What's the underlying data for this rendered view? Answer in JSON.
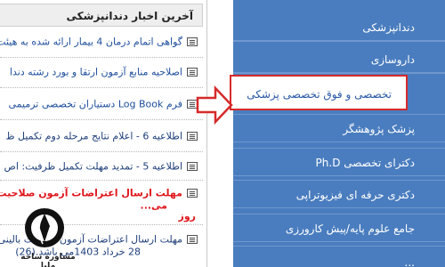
{
  "news": {
    "title": "آخرین اخبار دندانپزشکی",
    "items": [
      {
        "text": "گواهی اتمام درمان 4 بیمار ارائه شده به هیئت",
        "style": "normal"
      },
      {
        "text": "اصلاحیه منابع آزمون ارتقا و بورد رشته دندا",
        "style": "normal"
      },
      {
        "text": "فرم Log Book دستیاران تخصصی ترمیمی",
        "style": "normal"
      },
      {
        "text": "اطلاعیه 6 - اعلام نتایج مرحله دوم تکمیل ظ",
        "style": "dark"
      },
      {
        "text": "اطلاعیه 5 - تمدید مهلت تکمیل ظرفیت: اص",
        "style": "dark"
      },
      {
        "text": "مهلت ارسال اعتراضات آزمون صلاحیت",
        "style": "red"
      },
      {
        "text": "می...",
        "style": "red"
      },
      {
        "text": "روز",
        "style": "red"
      },
      {
        "text": "مهلت ارسال اعتراضات آزمون صلاحیت بالینی",
        "style": "dark"
      },
      {
        "text": "28 خرداد 1403می باشد.(26)",
        "style": "dark"
      }
    ]
  },
  "menu": {
    "items": [
      "دندانپزشکی",
      "داروسازی",
      "تخصصی و فوق تخصصی پزشکی",
      "پزشک پژوهشگر",
      "دکترای تخصصی Ph.D",
      "دکتری حرفه ای فیزیوتراپی",
      "جامع علوم پایه/پیش کارورزی",
      "..."
    ],
    "active_index": 2
  },
  "watermark": {
    "text": "مشاوره ساحه ملیا"
  },
  "colors": {
    "menu_bg": "#4a7dbf",
    "active_border": "#d72a2a",
    "news_link": "#1e4e9c",
    "news_alert": "#e0151b"
  }
}
